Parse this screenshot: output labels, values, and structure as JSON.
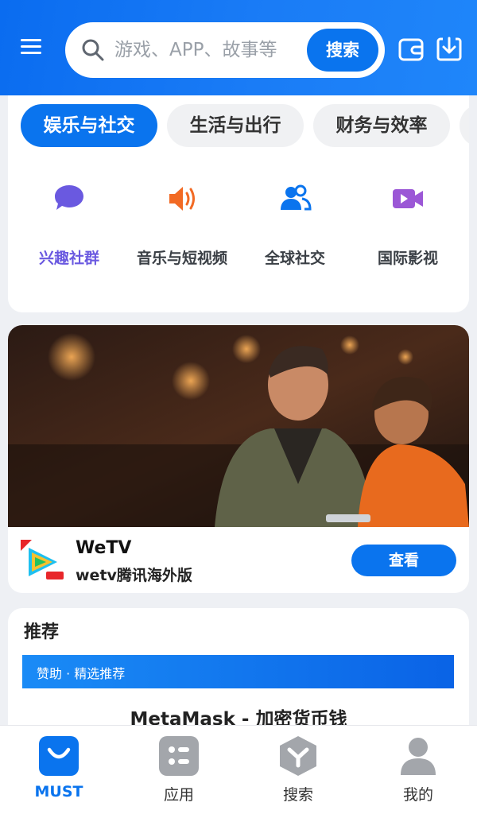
{
  "header": {
    "search_placeholder": "游戏、APP、故事等",
    "search_button": "搜索"
  },
  "categories": {
    "tabs": [
      {
        "label": "娱乐与社交",
        "active": true
      },
      {
        "label": "生活与出行",
        "active": false
      },
      {
        "label": "财务与效率",
        "active": false
      }
    ],
    "items": [
      {
        "label": "兴趣社群",
        "icon": "chat-bubble-icon"
      },
      {
        "label": "音乐与短视频",
        "icon": "speaker-icon"
      },
      {
        "label": "全球社交",
        "icon": "users-icon"
      },
      {
        "label": "国际影视",
        "icon": "video-camera-icon"
      }
    ]
  },
  "featured": {
    "app_name": "WeTV",
    "app_subtitle": "wetv腾讯海外版",
    "view_button": "查看"
  },
  "recommend": {
    "title": "推荐",
    "sponsor_label": "赞助 · 精选推荐",
    "app_title": "MetaMask - 加密货币钱"
  },
  "bottom_nav": [
    {
      "label": "MUST",
      "icon": "must-bag-icon",
      "active": true
    },
    {
      "label": "应用",
      "icon": "apps-grid-icon",
      "active": false
    },
    {
      "label": "搜索",
      "icon": "search-hex-icon",
      "active": false
    },
    {
      "label": "我的",
      "icon": "profile-icon",
      "active": false
    }
  ],
  "colors": {
    "primary": "#0a74ee",
    "purple": "#6a59e0",
    "orange": "#f26a24"
  }
}
